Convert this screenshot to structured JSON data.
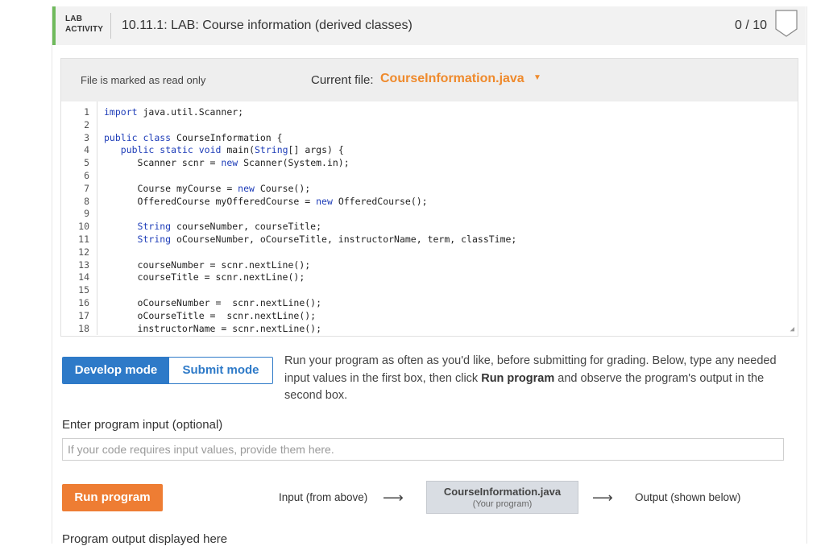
{
  "header": {
    "lab_line1": "LAB",
    "lab_line2": "ACTIVITY",
    "title": "10.11.1: LAB: Course information (derived classes)",
    "score": "0 / 10"
  },
  "editor": {
    "readonly_text": "File is marked as read only",
    "current_file_label": "Current file:",
    "current_file": "CourseInformation.java",
    "lines": [
      "import java.util.Scanner;",
      "",
      "public class CourseInformation {",
      "   public static void main(String[] args) {",
      "      Scanner scnr = new Scanner(System.in);",
      "",
      "      Course myCourse = new Course();",
      "      OfferedCourse myOfferedCourse = new OfferedCourse();",
      "",
      "      String courseNumber, courseTitle;",
      "      String oCourseNumber, oCourseTitle, instructorName, term, classTime;",
      "",
      "      courseNumber = scnr.nextLine();",
      "      courseTitle = scnr.nextLine();",
      "",
      "      oCourseNumber =  scnr.nextLine();",
      "      oCourseTitle =  scnr.nextLine();",
      "      instructorName = scnr.nextLine();"
    ],
    "line_numbers": [
      "1",
      "2",
      "3",
      "4",
      "5",
      "6",
      "7",
      "8",
      "9",
      "10",
      "11",
      "12",
      "13",
      "14",
      "15",
      "16",
      "17",
      "18"
    ]
  },
  "modes": {
    "develop": "Develop mode",
    "submit": "Submit mode"
  },
  "run_info": {
    "part1": "Run your program as often as you'd like, before submitting for grading. Below, type any needed input values in the first box, then click ",
    "bold": "Run program",
    "part2": " and observe the program's output in the second box."
  },
  "input": {
    "label": "Enter program input (optional)",
    "placeholder": "If your code requires input values, provide them here."
  },
  "run": {
    "button": "Run program",
    "flow_input": "Input (from above)",
    "program_file": "CourseInformation.java",
    "program_sub": "(Your program)",
    "flow_output": "Output (shown below)"
  },
  "output": {
    "label": "Program output displayed here"
  },
  "colors": {
    "accent_green": "#6fba5c",
    "file_orange": "#ef8a2c",
    "mode_blue": "#2e7ac8",
    "run_orange": "#ee7d33"
  }
}
